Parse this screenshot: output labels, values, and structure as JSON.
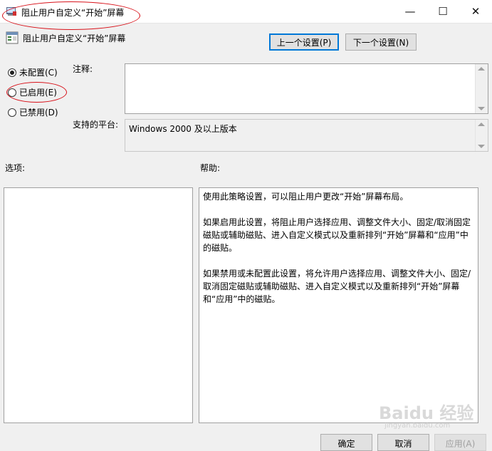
{
  "window": {
    "title": "阻止用户自定义“开始”屏幕",
    "controls": {
      "minimize": "—",
      "maximize": "☐",
      "close": "✕"
    }
  },
  "header": {
    "policy_name": "阻止用户自定义“开始”屏幕",
    "prev_button": "上一个设置(P)",
    "next_button": "下一个设置(N)"
  },
  "state_options": [
    {
      "label": "未配置(C)",
      "checked": true
    },
    {
      "label": "已启用(E)",
      "checked": false
    },
    {
      "label": "已禁用(D)",
      "checked": false
    }
  ],
  "comment": {
    "label": "注释:",
    "value": ""
  },
  "platform": {
    "label": "支持的平台:",
    "value": "Windows 2000 及以上版本"
  },
  "options": {
    "label": "选项:"
  },
  "help": {
    "label": "帮助:",
    "paragraphs": [
      "使用此策略设置，可以阻止用户更改“开始”屏幕布局。",
      "如果启用此设置，将阻止用户选择应用、调整文件大小、固定/取消固定磁贴或辅助磁贴、进入自定义模式以及重新排列“开始”屏幕和“应用”中的磁贴。",
      "如果禁用或未配置此设置，将允许用户选择应用、调整文件大小、固定/取消固定磁贴或辅助磁贴、进入自定义模式以及重新排列“开始”屏幕和“应用”中的磁贴。"
    ]
  },
  "footer": {
    "ok": "确定",
    "cancel": "取消",
    "apply": "应用(A)"
  },
  "watermark": {
    "main": "Baidu 经验",
    "sub": "jingyan.baidu.com"
  },
  "colors": {
    "annotation": "#d8121a",
    "focus": "#0078d7"
  }
}
